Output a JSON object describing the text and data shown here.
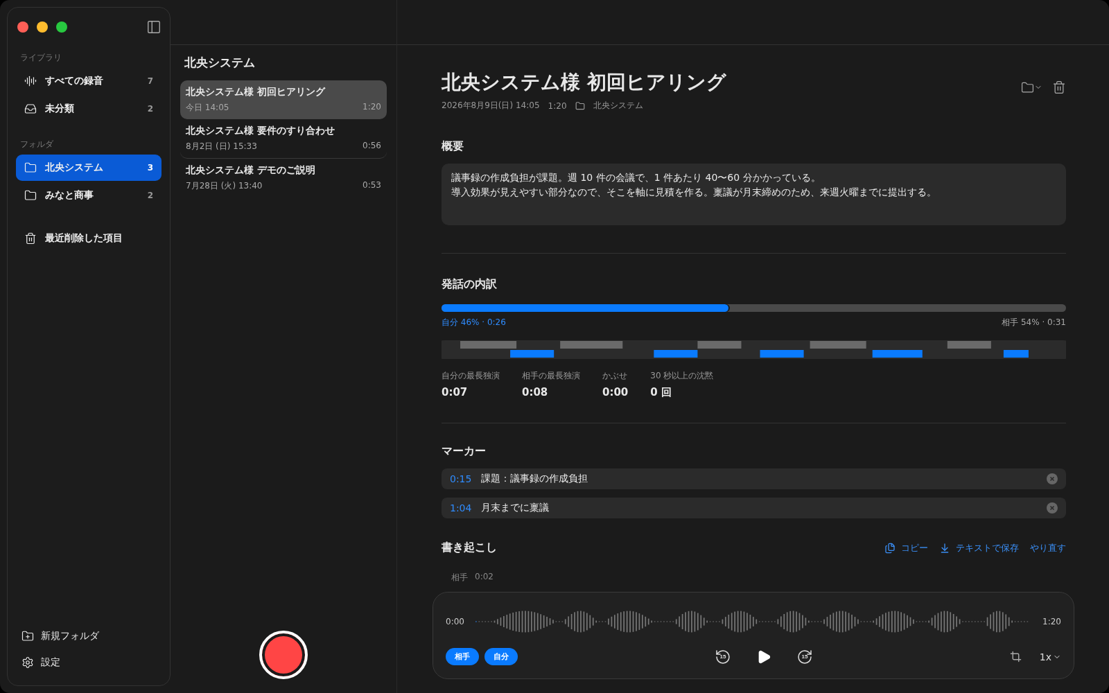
{
  "sidebar": {
    "sections": [
      {
        "heading": "ライブラリ",
        "items": [
          {
            "kind": "all",
            "label": "すべての録音",
            "count": "7",
            "selected": false
          },
          {
            "kind": "inbox",
            "label": "未分類",
            "count": "2",
            "selected": false
          }
        ]
      },
      {
        "heading": "フォルダ",
        "items": [
          {
            "kind": "folder",
            "label": "北央システム",
            "count": "3",
            "selected": true
          },
          {
            "kind": "folder",
            "label": "みなと商事",
            "count": "2",
            "selected": false
          }
        ]
      }
    ],
    "trash": "最近削除した項目",
    "footer": [
      {
        "kind": "new_folder",
        "label": "新規フォルダ"
      },
      {
        "kind": "settings",
        "label": "設定"
      }
    ]
  },
  "list": {
    "title": "北央システム",
    "recordings": [
      {
        "title": "北央システム様 初回ヒアリング",
        "date": "今日 14:05",
        "duration": "1:20",
        "selected": true
      },
      {
        "title": "北央システム様 要件のすり合わせ",
        "date": "8月2日 (日) 15:33",
        "duration": "0:56",
        "selected": false
      },
      {
        "title": "北央システム様 デモのご説明",
        "date": "7月28日 (火) 13:40",
        "duration": "0:53",
        "selected": false
      }
    ]
  },
  "detail": {
    "title": "北央システム様 初回ヒアリング",
    "meta": {
      "date": "2026年8月9日(日) 14:05",
      "duration": "1:20",
      "folder": "北央システム"
    },
    "summary": {
      "heading": "概要",
      "lines": [
        "議事録の作成負担が課題。週 10 件の会議で、1 件あたり 40〜60 分かかっている。",
        "導入効果が見えやすい部分なので、そこを軸に見積を作る。稟議が月末締めのため、来週火曜までに提出する。"
      ]
    },
    "talk": {
      "heading": "発話の内訳",
      "self_label": "自分 46% · 0:26",
      "level": 0.46,
      "other_label": "相手 54% · 0:31",
      "stats": [
        {
          "label": "自分の最長独演",
          "value": "0:07"
        },
        {
          "label": "相手の最長独演",
          "value": "0:08"
        },
        {
          "label": "かぶせ",
          "value": "0:00"
        },
        {
          "label": "30 秒以上の沈黙",
          "value": "0 回"
        }
      ]
    },
    "markers": {
      "heading": "マーカー",
      "items": [
        {
          "time": "0:15",
          "label": "課題：議事録の作成負担"
        },
        {
          "time": "1:04",
          "label": "月末までに稟議"
        }
      ]
    },
    "transcript": {
      "heading": "書き起こし",
      "actions": [
        {
          "kind": "copy",
          "label": "コピー"
        },
        {
          "kind": "save",
          "label": "テキストで保存"
        },
        {
          "kind": "redo",
          "label": "やり直す"
        }
      ],
      "entries": [
        {
          "speaker": "相手",
          "time": "0:02"
        }
      ]
    }
  },
  "player": {
    "start": "0:00",
    "end": "1:20",
    "speakers": [
      {
        "label": "相手",
        "on": true
      },
      {
        "label": "自分",
        "on": true
      }
    ],
    "skip_back": "15",
    "skip_forward": "15",
    "speed": "1x"
  }
}
